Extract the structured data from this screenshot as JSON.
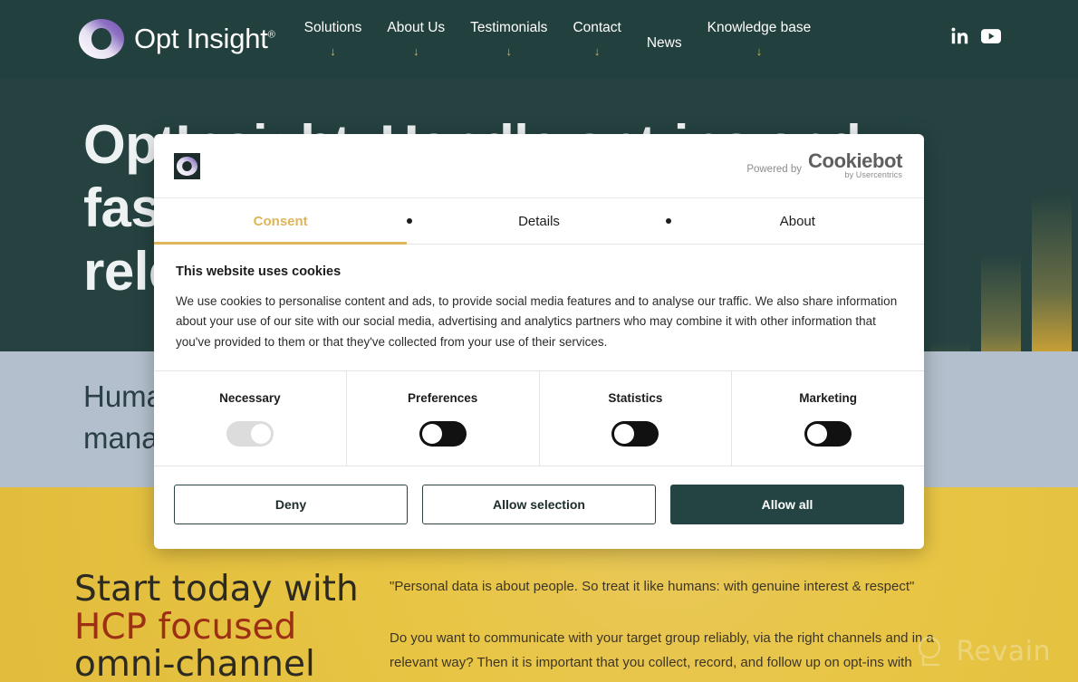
{
  "site": {
    "brand_name": "Opt Insight",
    "brand_tm": "®",
    "nav": [
      {
        "label": "Solutions",
        "caret": "↓"
      },
      {
        "label": "About Us",
        "caret": "↓"
      },
      {
        "label": "Testimonials",
        "caret": "↓"
      },
      {
        "label": "Contact",
        "caret": "↓"
      },
      {
        "label": "News",
        "caret": ""
      },
      {
        "label": "Knowledge base",
        "caret": "↓"
      }
    ],
    "social": [
      {
        "name": "linkedin-icon",
        "label": "in"
      },
      {
        "name": "youtube-icon",
        "label": "▶"
      }
    ]
  },
  "hero": {
    "title": "OptInsight. Handle opt-ins and\nfaster, with more care and\nrelevance",
    "subtitle": "Humanising opt-in\nmanagement",
    "cta_line1": "Start today with",
    "cta_highlight": "HCP focused",
    "cta_line3": "omni-channel",
    "quote": "\"Personal data is about people. So treat it like humans: with genuine interest & respect\"",
    "body": "Do you want to communicate with your target group reliably, via the right channels and in a relevant way? Then it is important that you collect, record, and follow up on opt-ins with"
  },
  "watermark": {
    "text": "Revain"
  },
  "cookie_dialog": {
    "powered_by": "Powered by",
    "provider_name": "Cookiebot",
    "provider_sub": "by Usercentrics",
    "tabs": [
      {
        "label": "Consent",
        "active": true
      },
      {
        "label": "Details",
        "active": false
      },
      {
        "label": "About",
        "active": false
      }
    ],
    "heading": "This website uses cookies",
    "paragraph": "We use cookies to personalise content and ads, to provide social media features and to analyse our traffic. We also share information about your use of our site with our social media, advertising and analytics partners who may combine it with other information that you've provided to them or that they've collected from your use of their services.",
    "categories": [
      {
        "name": "Necessary",
        "state": "on-locked"
      },
      {
        "name": "Preferences",
        "state": "off"
      },
      {
        "name": "Statistics",
        "state": "off"
      },
      {
        "name": "Marketing",
        "state": "off"
      }
    ],
    "buttons": {
      "deny": "Deny",
      "allow_selection": "Allow selection",
      "allow_all": "Allow all"
    }
  },
  "colors": {
    "header_bg": "#22403d",
    "hero_bg": "#254240",
    "band_blue": "#b3bfcc",
    "band_yellow": "#e8c544",
    "accent_gold": "#ddb55a",
    "primary_btn": "#234442",
    "highlight_red": "#9d2f15"
  }
}
